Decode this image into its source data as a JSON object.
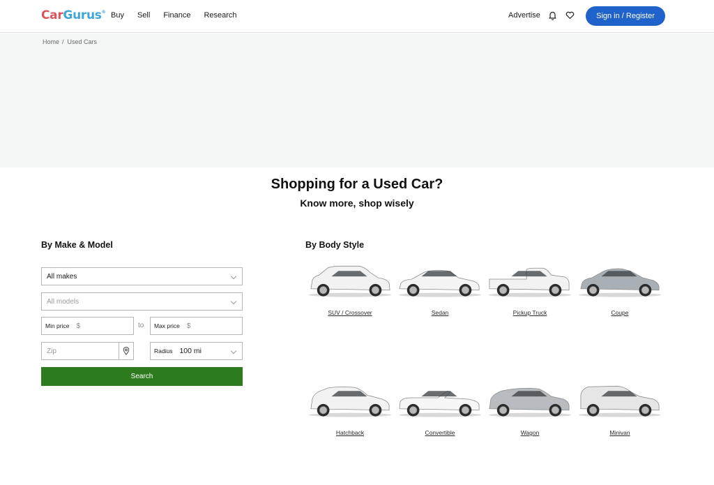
{
  "header": {
    "logo": {
      "part1": "Car",
      "part2": "Gurus",
      "mark": "®"
    },
    "nav": [
      {
        "label": "Buy"
      },
      {
        "label": "Sell"
      },
      {
        "label": "Finance"
      },
      {
        "label": "Research"
      }
    ],
    "advertise_label": "Advertise",
    "icons": [
      "bell-icon",
      "heart-icon"
    ],
    "signin_label": "Sign in / Register",
    "signin_color": "#1f62c9"
  },
  "breadcrumb": [
    {
      "label": "Home"
    },
    {
      "label": "Used Cars"
    }
  ],
  "breadcrumb_sep": "/",
  "hero": {
    "title": "Shopping for a Used Car?",
    "subtitle": "Know more, shop wisely"
  },
  "make_model": {
    "title": "By Make & Model",
    "make_select": {
      "value": "All makes"
    },
    "model_select": {
      "placeholder": "All models"
    },
    "min_price": {
      "label": "Min price",
      "prefix": "$",
      "value": ""
    },
    "to_label": "to",
    "max_price": {
      "label": "Max price",
      "prefix": "$",
      "value": ""
    },
    "zip": {
      "placeholder": "Zip",
      "value": ""
    },
    "radius": {
      "label": "Radius",
      "value": "100 mi"
    },
    "search_label": "Search",
    "search_color": "#2d7a1f"
  },
  "body_style": {
    "title": "By Body Style",
    "items": [
      {
        "label": "SUV / Crossover",
        "color": "#f2f2f2"
      },
      {
        "label": "Sedan",
        "color": "#f4f4f4"
      },
      {
        "label": "Pickup Truck",
        "color": "#f2f2f2"
      },
      {
        "label": "Coupe",
        "color": "#a9b0b5"
      },
      {
        "label": "Hatchback",
        "color": "#f2f2f2"
      },
      {
        "label": "Convertible",
        "color": "#f6f6f6"
      },
      {
        "label": "Wagon",
        "color": "#b8bcc0"
      },
      {
        "label": "Minivan",
        "color": "#e6e6e6"
      }
    ]
  }
}
